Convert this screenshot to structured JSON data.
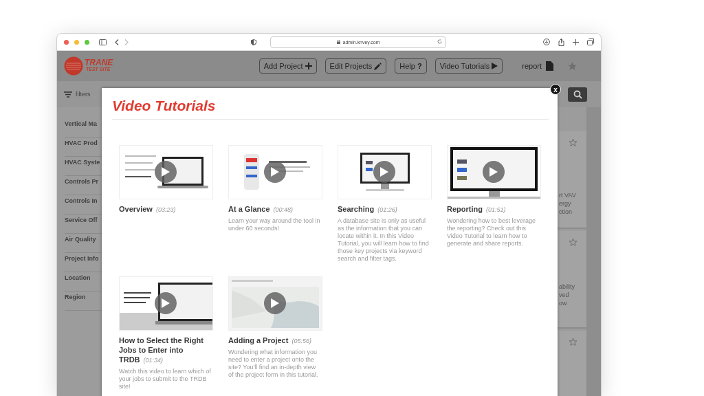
{
  "browser": {
    "url": "admin.knvey.com"
  },
  "header": {
    "logo": {
      "name": "TRANE",
      "subtitle": "TEST SITE"
    },
    "buttons": [
      {
        "label": "Add Project"
      },
      {
        "label": "Edit Projects"
      },
      {
        "label": "Help",
        "glyph": "?"
      },
      {
        "label": "Video Tutorials"
      }
    ],
    "report": "report"
  },
  "filters": {
    "label": "filters"
  },
  "sidebar": {
    "items": [
      "Vertical Ma",
      "HVAC Prod",
      "HVAC Syste",
      "Controls Pr",
      "Controls In",
      "Service Off",
      "Air Quality",
      "Project Info",
      "Location",
      "Region"
    ]
  },
  "result_cards": [
    {
      "excerpt": "rt VAV\nergy\nction",
      "starred": false
    },
    {
      "excerpt": "ability\nved\now",
      "starred": false
    },
    {
      "starred": false
    }
  ],
  "modal": {
    "title": "Video Tutorials",
    "close": "x",
    "videos": [
      {
        "title": "Overview",
        "duration": "(03:23)"
      },
      {
        "title": "At a Glance",
        "duration": "(00:48)",
        "description": "Learn your way around the tool in under 60 seconds!"
      },
      {
        "title": "Searching",
        "duration": "(01:26)",
        "description": "A database site is only as useful as the information that you can locate within it. In this Video Tutorial, you will learn how to find those key projects via keyword search and filter tags."
      },
      {
        "title": "Reporting",
        "duration": "(01:51)",
        "description": "Wondering how to best leverage the reporting? Check out this Video Tutorial to learn how to generate and share reports."
      },
      {
        "title": "How to Select the Right Jobs to Enter into TRDB",
        "duration": "(01:34)",
        "description": "Watch this video to learn which of your jobs to submit to the TRDB site!"
      },
      {
        "title": "Adding a Project",
        "duration": "(05:56)",
        "description": "Wondering what information you need to enter a project onto the site? You'll find an in-depth view of the project form in this tutorial."
      }
    ]
  }
}
